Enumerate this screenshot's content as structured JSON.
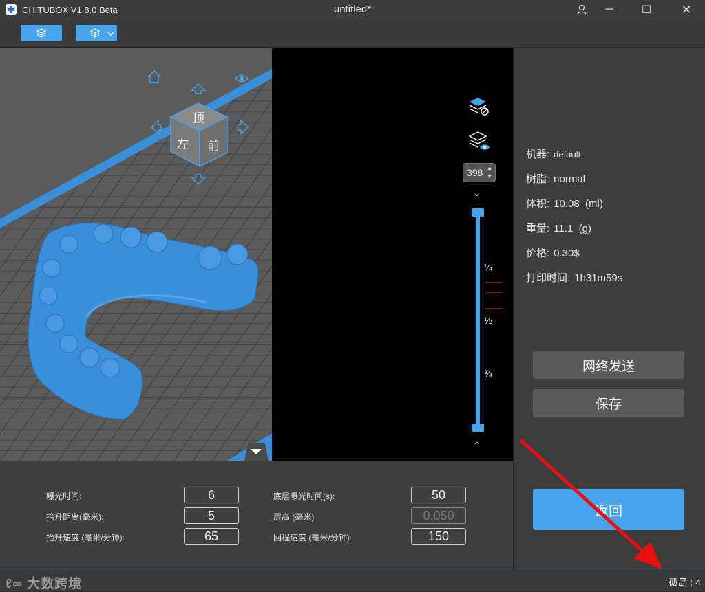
{
  "app": {
    "name": "CHITUBOX V1.8.0 Beta",
    "document_title": "untitled*"
  },
  "window_controls": {
    "user": "user-icon",
    "minimize": "─",
    "maximize": "☐",
    "close": "✕"
  },
  "viewcube": {
    "top_face": "顶",
    "left_face": "左",
    "front_face": "前"
  },
  "slice_view": {
    "layer_value": "398",
    "fractions": [
      "¼",
      "½",
      "¾"
    ],
    "slider_top_fraction": 1.0,
    "slider_bottom_fraction": 0.0
  },
  "info": {
    "machine_label": "机器:",
    "machine_value": "default",
    "resin_label": "树脂:",
    "resin_value": "normal",
    "volume_label": "体积:",
    "volume_value": "10.08  (ml)",
    "weight_label": "重量:",
    "weight_value": "11.1  (g)",
    "price_label": "价格:",
    "price_value": "0.30$",
    "time_label": "打印时间:",
    "time_value": "1h31m59s"
  },
  "buttons": {
    "network_send": "网络发送",
    "save": "保存",
    "back": "返回"
  },
  "params": {
    "exposure_label": "曝光时间:",
    "exposure_value": "6",
    "lift_dist_label": "抬升距离(毫米):",
    "lift_dist_value": "5",
    "lift_speed_label": "抬升速度 (毫米/分钟):",
    "lift_speed_value": "65",
    "bottom_exposure_label": "底层曝光时间(s):",
    "bottom_exposure_value": "50",
    "layer_height_label": "层高 (毫米)",
    "layer_height_value": "0.050",
    "retract_speed_label": "回程速度 (毫米/分钟):",
    "retract_speed_value": "150"
  },
  "status": {
    "islands": "孤岛 : 4",
    "watermark": "大数跨境"
  },
  "colors": {
    "accent": "#4aa3e8",
    "model": "#3a8fd8",
    "arrow": "#e81010"
  }
}
